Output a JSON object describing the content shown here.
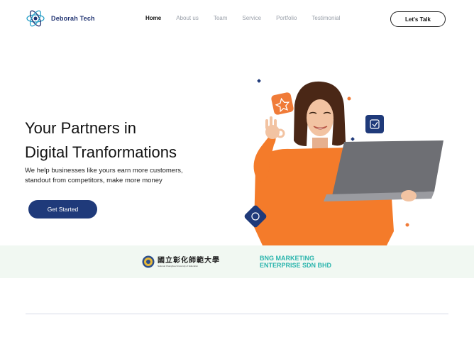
{
  "brand": {
    "name": "Deborah Tech"
  },
  "nav": {
    "items": [
      {
        "label": "Home",
        "active": true
      },
      {
        "label": "About us",
        "active": false
      },
      {
        "label": "Team",
        "active": false
      },
      {
        "label": "Service",
        "active": false
      },
      {
        "label": "Portfolio",
        "active": false
      },
      {
        "label": "Testimonial",
        "active": false
      }
    ],
    "cta_label": "Let's Talk"
  },
  "hero": {
    "title_line1": "Your Partners in",
    "title_line2": "Digital Tranformations",
    "subtitle_line1": "We help businesses like yours earn more customers,",
    "subtitle_line2": "standout from competitors, make more money",
    "button_label": "Get Started"
  },
  "partners": {
    "university_name": "國立彰化師範大學",
    "university_subtitle": "National Changhua University of Education",
    "company_line1": "BNG MARKETING",
    "company_line2": "ENTERPRISE SDN BHD"
  },
  "colors": {
    "brand_navy": "#1f3a7a",
    "accent_orange": "#f07b38",
    "partner_teal": "#2bb5ad",
    "band_bg": "#f1f8f2"
  },
  "icons": [
    "atom-logo-icon",
    "star-badge-icon",
    "check-badge-icon",
    "swap-badge-icon",
    "university-seal-icon"
  ]
}
